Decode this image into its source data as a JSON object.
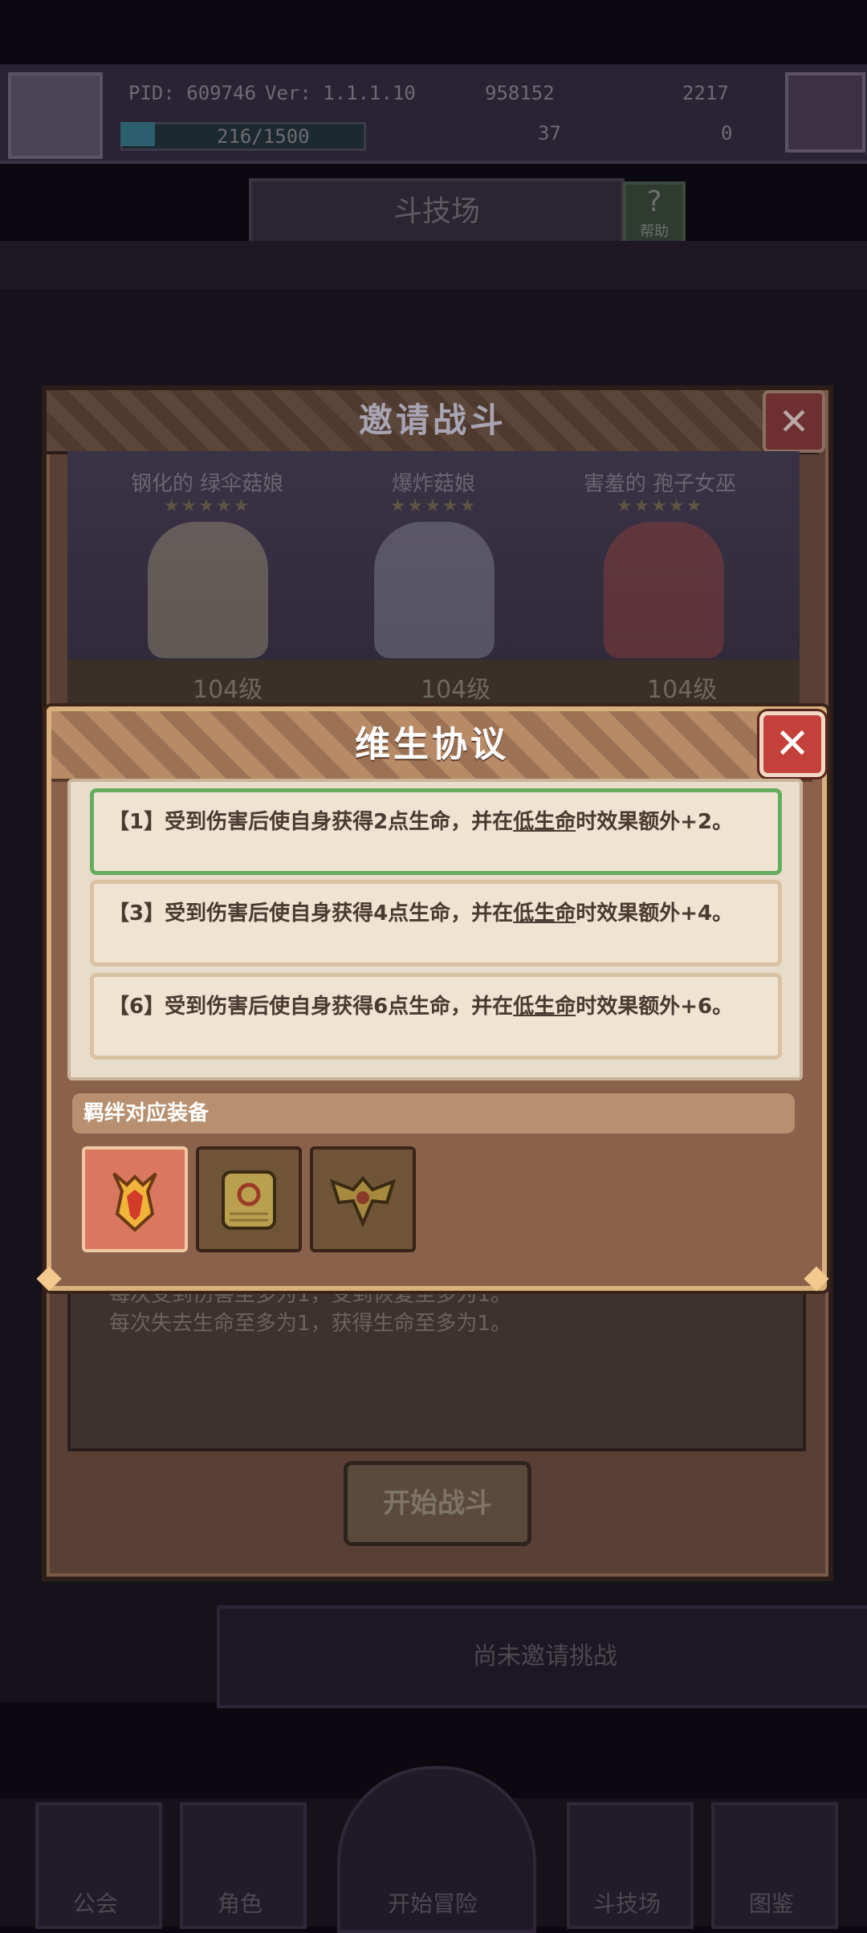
{
  "topbar": {
    "pid": "PID: 609746",
    "version": "Ver: 1.1.1.10",
    "currency1": "958152",
    "currency2": "2217",
    "exp": "216/1500",
    "exp_fraction": 0.144,
    "stat3": "37",
    "stat4": "0"
  },
  "arena": {
    "title": "斗技场",
    "help": "帮助"
  },
  "invite": {
    "title": "邀请战斗",
    "heroes": [
      {
        "name": "钢化的 绿伞菇娘",
        "stars": "★★★★★",
        "level": "104级",
        "color": "#b9b38a"
      },
      {
        "name": "爆炸菇娘",
        "stars": "★★★★★",
        "level": "104级",
        "color": "#9ea0b0"
      },
      {
        "name": "害羞的 孢子女巫",
        "stars": "★★★★★",
        "level": "104级",
        "color": "#b0453a"
      }
    ],
    "body_line1": "每次受到伤害至多为1，受到恢复至多为1。",
    "body_line2": "每次失去生命至多为1，获得生命至多为1。",
    "start_button": "开始战斗"
  },
  "popup": {
    "title": "维生协议",
    "effects": [
      {
        "prefix": "【1】受到伤害后使自身获得2点生命，并在",
        "keyword": "低生命",
        "suffix": "时效果额外+2。",
        "active": true
      },
      {
        "prefix": "【3】受到伤害后使自身获得4点生命，并在",
        "keyword": "低生命",
        "suffix": "时效果额外+4。",
        "active": false
      },
      {
        "prefix": "【6】受到伤害后使自身获得6点生命，并在",
        "keyword": "低生命",
        "suffix": "时效果额外+6。",
        "active": false
      }
    ],
    "bond_label": "羁绊对应装备",
    "equipment_icons": [
      "golden-helmet-icon",
      "shield-plate-icon",
      "winged-armor-icon"
    ]
  },
  "status": {
    "not_invited": "尚未邀请挑战"
  },
  "nav": {
    "items": [
      "公会",
      "角色",
      "开始冒险",
      "斗技场",
      "图鉴"
    ]
  },
  "colors": {
    "accent_gold": "#d9b07c",
    "active_green": "#63ad5d",
    "close_red": "#c4403a"
  }
}
